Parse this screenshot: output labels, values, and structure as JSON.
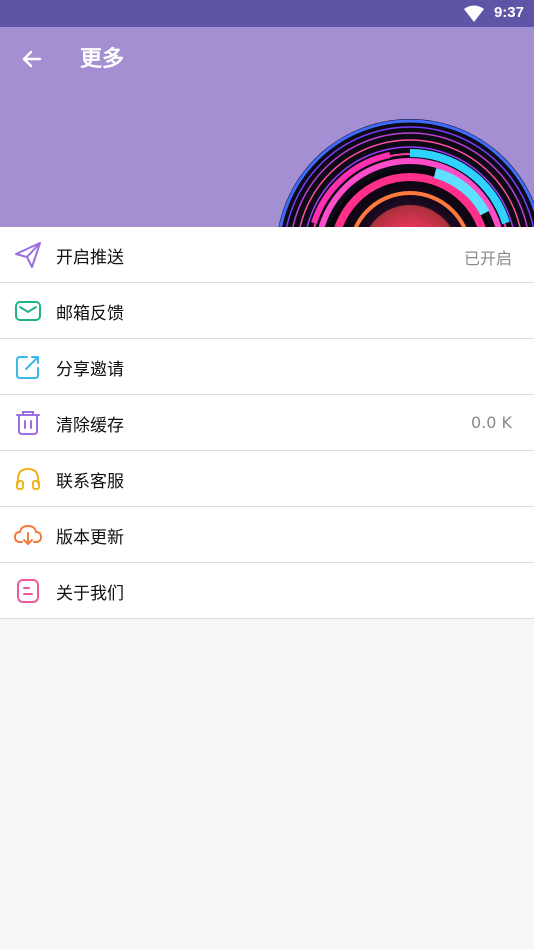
{
  "status_bar": {
    "time": "9:37"
  },
  "header": {
    "title": "更多"
  },
  "menu": {
    "items": [
      {
        "label": "开启推送",
        "value": "已开启",
        "icon": "paper-plane-icon",
        "color": "#9b6fe0"
      },
      {
        "label": "邮箱反馈",
        "value": "",
        "icon": "mail-icon",
        "color": "#1fb38a"
      },
      {
        "label": "分享邀请",
        "value": "",
        "icon": "share-icon",
        "color": "#3bb7ea"
      },
      {
        "label": "清除缓存",
        "value": "0.0 K",
        "icon": "trash-icon",
        "color": "#9b6fe0"
      },
      {
        "label": "联系客服",
        "value": "",
        "icon": "headset-icon",
        "color": "#f2b31d"
      },
      {
        "label": "版本更新",
        "value": "",
        "icon": "cloud-download-icon",
        "color": "#f47c3c"
      },
      {
        "label": "关于我们",
        "value": "",
        "icon": "about-icon",
        "color": "#ee5a9a"
      }
    ]
  }
}
